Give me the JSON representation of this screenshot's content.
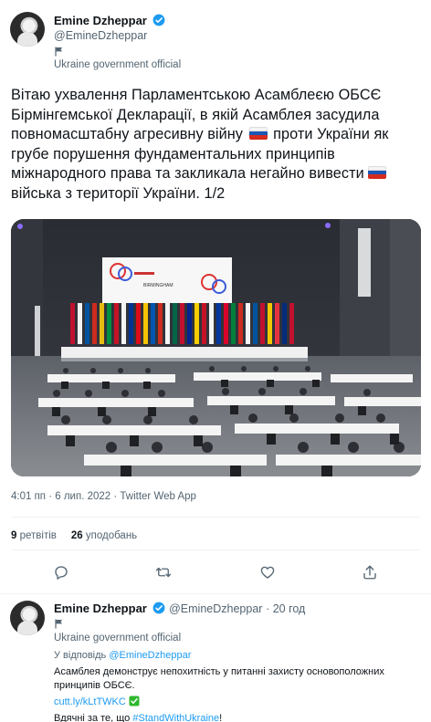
{
  "main_tweet": {
    "author": {
      "name": "Emine Dzheppar",
      "handle": "@EmineDzheppar",
      "label": "Ukraine government official"
    },
    "text_parts": {
      "p1": "Вітаю ухвалення Парламентською Асамблеєю ОБСЄ Бірмінгемської Декларації, в якій Асамблея засудила повномасштабну агресивну війну",
      "p2": "проти України як грубе порушення фундаментальних принципів міжнародного права та закликала негайно вивести",
      "p3": "війська з території України. 1/2"
    },
    "flag_emoji": "russia-flag",
    "photo": {
      "screen_text": "BIRMINGHAM"
    },
    "meta": "4:01 пп · 6 лип. 2022 · Twitter Web App",
    "stats": {
      "retweets_count": "9",
      "retweets_label": "ретвітів",
      "likes_count": "26",
      "likes_label": "уподобань"
    },
    "actions": [
      "reply-icon",
      "retweet-icon",
      "like-icon",
      "share-icon"
    ]
  },
  "reply_tweet": {
    "author": {
      "name": "Emine Dzheppar",
      "handle": "@EmineDzheppar",
      "time": "· 20 год",
      "label": "Ukraine government official"
    },
    "replying_prefix": "У відповідь",
    "replying_to": "@EmineDzheppar",
    "text_line1": "Асамблея демонструє непохитність у питанні захисту основоположних",
    "text_line2": "принципів ОБСЄ.",
    "link": "cutt.ly/kLtTWKC",
    "thanks_prefix": "Вдячні за те, що",
    "hashtag": "#StandWithUkraine",
    "thanks_suffix": "!"
  },
  "colors": {
    "accent": "#1d9bf0",
    "text": "#0f1419",
    "muted": "#536471"
  }
}
